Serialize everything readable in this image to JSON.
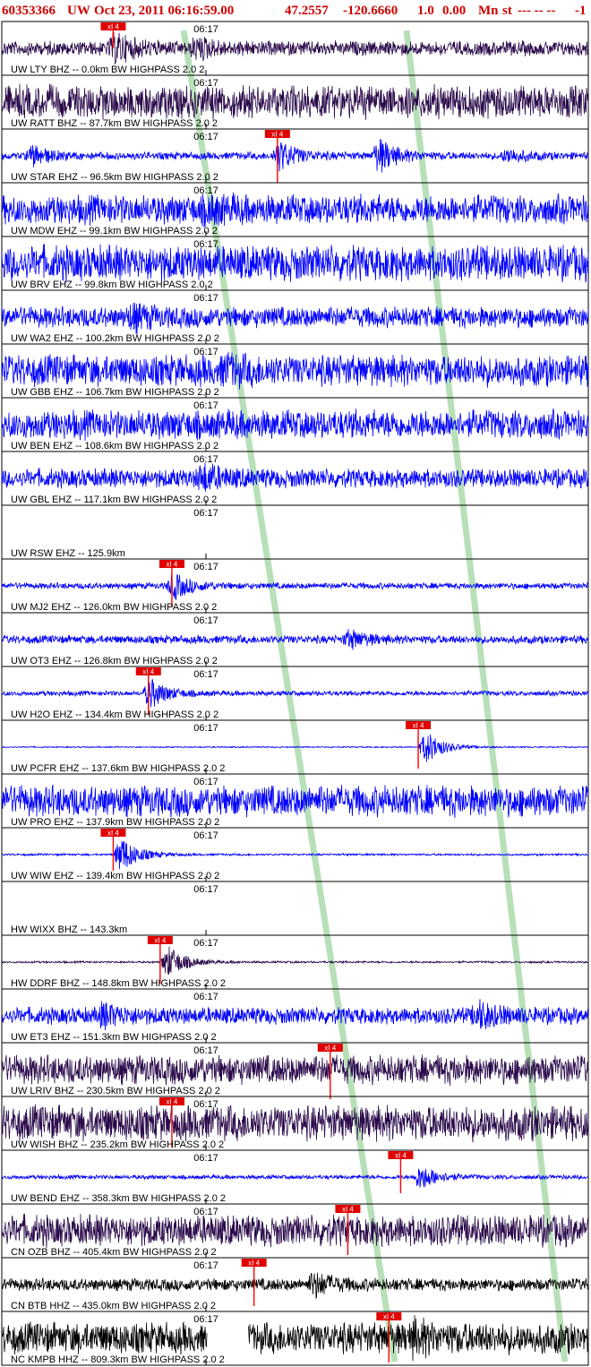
{
  "header": {
    "event_id": "60353366",
    "network": "UW",
    "date": "Oct 23, 2011 06:16:59.00",
    "lat": "47.2557",
    "lon": "-120.6660",
    "magnitude": "1.0",
    "mag_extra": "0.00",
    "mag_type": "Mn",
    "status": "st",
    "dashes": "--- -- --",
    "end_flag": "-1"
  },
  "colors": {
    "blue": "#0000ff",
    "purple": "#2a0a4a",
    "black": "#000000",
    "pick": "#ff0000",
    "pick_label": "#e00000",
    "phase_band": "#b8e0b8",
    "title": "#d00000"
  },
  "chart_data": {
    "type": "line",
    "title": "60353366 UW Oct 23, 2011 06:16:59.00 47.2557 -120.6660 1.0 0.00 Mn st --- -- -- -1",
    "xlabel": "",
    "ylabel": "",
    "time_tick_label": "06:17",
    "pick_label": "xI 4",
    "traces": [
      {
        "label": "UW LTY BHZ -- 0.0km BW HIGHPASS 2.0 2",
        "color": "purple",
        "amp": 0.35,
        "pick": 0.19,
        "bursts": [
          [
            0.19,
            0.6
          ],
          [
            0.33,
            0.4
          ]
        ],
        "spike": 0,
        "gap": null,
        "empty": false
      },
      {
        "label": "UW RATT BHZ -- 87.7km BW HIGHPASS 2.0 2",
        "color": "purple",
        "amp": 0.8,
        "pick": null,
        "bursts": [],
        "spike": 0,
        "gap": null,
        "empty": false
      },
      {
        "label": "UW STAR EHZ -- 96.5km BW HIGHPASS 2.0 2",
        "color": "blue",
        "amp": 0.18,
        "pick": 0.47,
        "bursts": [
          [
            0.05,
            0.45
          ],
          [
            0.47,
            0.7
          ],
          [
            0.64,
            0.8
          ],
          [
            0.86,
            0.3
          ]
        ],
        "spike": 1.0,
        "gap": null,
        "empty": false
      },
      {
        "label": "UW MDW EHZ -- 99.1km BW HIGHPASS 2.0 2",
        "color": "blue",
        "amp": 0.7,
        "pick": null,
        "bursts": [
          [
            0.35,
            0.3
          ]
        ],
        "spike": 0,
        "gap": null,
        "empty": false
      },
      {
        "label": "UW BRV EHZ -- 99.8km BW HIGHPASS 2.0 2",
        "color": "blue",
        "amp": 0.85,
        "pick": null,
        "bursts": [],
        "spike": 0,
        "gap": null,
        "empty": false
      },
      {
        "label": "UW WA2 EHZ -- 100.2km BW HIGHPASS 2.0 2",
        "color": "blue",
        "amp": 0.5,
        "pick": null,
        "bursts": [
          [
            0.22,
            0.4
          ]
        ],
        "spike": 0,
        "gap": null,
        "empty": false
      },
      {
        "label": "UW GBB EHZ -- 106.7km BW HIGHPASS 2.0 2",
        "color": "blue",
        "amp": 0.75,
        "pick": null,
        "bursts": [
          [
            0.38,
            0.3
          ]
        ],
        "spike": 0,
        "gap": null,
        "empty": false
      },
      {
        "label": "UW BEN EHZ -- 108.6km BW HIGHPASS 2.0 2",
        "color": "blue",
        "amp": 0.7,
        "pick": null,
        "bursts": [],
        "spike": 0,
        "gap": null,
        "empty": false
      },
      {
        "label": "UW GBL EHZ -- 117.1km BW HIGHPASS 2.0 2",
        "color": "blue",
        "amp": 0.45,
        "pick": null,
        "bursts": [
          [
            0.34,
            0.5
          ]
        ],
        "spike": 0,
        "gap": null,
        "empty": false
      },
      {
        "label": "UW RSW EHZ -- 125.9km",
        "color": "blue",
        "amp": 0,
        "pick": null,
        "bursts": [],
        "spike": 0,
        "gap": null,
        "empty": true
      },
      {
        "label": "UW MJ2 EHZ -- 126.0km BW HIGHPASS 2.0 2",
        "color": "blue",
        "amp": 0.15,
        "pick": 0.29,
        "bursts": [
          [
            0.29,
            0.6
          ]
        ],
        "spike": 0.8,
        "gap": null,
        "empty": false
      },
      {
        "label": "UW OT3 EHZ -- 126.8km BW HIGHPASS 2.0 2",
        "color": "blue",
        "amp": 0.2,
        "pick": null,
        "bursts": [
          [
            0.59,
            0.4
          ]
        ],
        "spike": 0,
        "gap": null,
        "empty": false
      },
      {
        "label": "UW H2O EHZ -- 134.4km BW HIGHPASS 2.0 2",
        "color": "blue",
        "amp": 0.12,
        "pick": 0.25,
        "bursts": [
          [
            0.25,
            0.7
          ]
        ],
        "spike": 0.8,
        "gap": null,
        "empty": false
      },
      {
        "label": "UW PCFR EHZ -- 137.6km BW HIGHPASS 2.0 2",
        "color": "blue",
        "amp": 0.03,
        "pick": 0.71,
        "bursts": [
          [
            0.72,
            0.8
          ]
        ],
        "spike": 0.8,
        "gap": null,
        "empty": false
      },
      {
        "label": "UW PRO EHZ -- 137.9km BW HIGHPASS 2.0 2",
        "color": "blue",
        "amp": 0.75,
        "pick": null,
        "bursts": [],
        "spike": 0,
        "gap": null,
        "empty": false
      },
      {
        "label": "UW WIW EHZ -- 139.4km BW HIGHPASS 2.0 2",
        "color": "blue",
        "amp": 0.05,
        "pick": 0.19,
        "bursts": [
          [
            0.2,
            0.9
          ]
        ],
        "spike": 0.6,
        "gap": null,
        "empty": false
      },
      {
        "label": "HW WIXX BHZ -- 143.3km",
        "color": "blue",
        "amp": 0,
        "pick": null,
        "bursts": [],
        "spike": 0,
        "gap": null,
        "empty": true
      },
      {
        "label": "HW DDRF BHZ -- 148.8km BW HIGHPASS 2.0 2",
        "color": "purple",
        "amp": 0.05,
        "pick": 0.27,
        "bursts": [
          [
            0.28,
            0.8
          ]
        ],
        "spike": 0.8,
        "gap": null,
        "empty": false
      },
      {
        "label": "UW ET3 EHZ -- 151.3km BW HIGHPASS 2.0 2",
        "color": "blue",
        "amp": 0.4,
        "pick": null,
        "bursts": [
          [
            0.81,
            0.5
          ],
          [
            0.17,
            0.4
          ]
        ],
        "spike": 0,
        "gap": null,
        "empty": false
      },
      {
        "label": "UW LRIV BHZ -- 230.5km BW HIGHPASS 2.0 2",
        "color": "purple",
        "amp": 0.7,
        "pick": 0.56,
        "bursts": [],
        "spike": 1.1,
        "gap": null,
        "empty": false
      },
      {
        "label": "UW WISH BHZ -- 235.2km BW HIGHPASS 2.0 2",
        "color": "purple",
        "amp": 0.85,
        "pick": 0.29,
        "bursts": [],
        "spike": 0.9,
        "gap": null,
        "empty": false
      },
      {
        "label": "UW BEND EHZ -- 358.3km BW HIGHPASS 2.0 2",
        "color": "blue",
        "amp": 0.1,
        "pick": 0.68,
        "bursts": [
          [
            0.71,
            0.6
          ]
        ],
        "spike": 0.6,
        "gap": null,
        "empty": false
      },
      {
        "label": "CN OZB BHZ -- 405.4km BW HIGHPASS 2.0 2",
        "color": "purple",
        "amp": 0.75,
        "pick": 0.59,
        "bursts": [],
        "spike": 0.9,
        "gap": null,
        "empty": false
      },
      {
        "label": "CN BTB HHZ -- 435.0km BW HIGHPASS 2.0 2",
        "color": "black",
        "amp": 0.3,
        "pick": 0.43,
        "bursts": [
          [
            0.53,
            0.5
          ]
        ],
        "spike": 0.8,
        "gap": null,
        "empty": false
      },
      {
        "label": "NC KMPB HHZ -- 809.3km BW HIGHPASS 2.0 2",
        "color": "black",
        "amp": 0.75,
        "pick": 0.66,
        "bursts": [
          [
            0.7,
            0.4
          ]
        ],
        "spike": 0.9,
        "gap": [
          0.35,
          0.42
        ],
        "empty": false
      }
    ],
    "phase_lines": [
      {
        "name": "P",
        "x_start": 0.31,
        "x_end": 0.67
      },
      {
        "name": "S",
        "x_start": 0.69,
        "x_end": 0.96
      }
    ]
  }
}
